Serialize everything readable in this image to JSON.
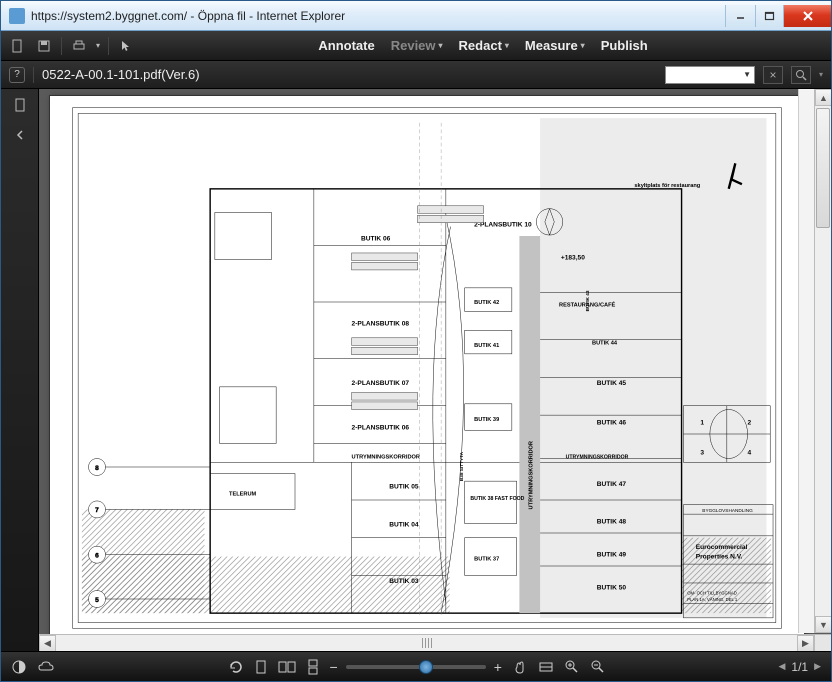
{
  "window": {
    "url_title": "https://system2.byggnet.com/ - Öppna fil - Internet Explorer"
  },
  "menu": {
    "annotate": "Annotate",
    "review": "Review",
    "redact": "Redact",
    "measure": "Measure",
    "publish": "Publish"
  },
  "subbar": {
    "help": "?",
    "filename": "0522-A-00.1-101.pdf(Ver.6)",
    "close_x": "×"
  },
  "plan": {
    "skylt": "skyltplats för\nrestaurang",
    "butik06": "BUTIK 06",
    "butik05": "BUTIK 05",
    "butik04": "BUTIK 04",
    "butik03": "BUTIK 03",
    "butik39": "BUTIK 39",
    "butik38": "BUTIK 38\nFAST FOOD",
    "butik37": "BUTIK 37",
    "butik41": "BUTIK 41",
    "butik42": "BUTIK 42",
    "butik43": "BUTIK 43",
    "butik44": "BUTIK 44",
    "butik45": "BUTIK 45",
    "butik46": "BUTIK 46",
    "butik47": "BUTIK 47",
    "butik48": "BUTIK 48",
    "butik49": "BUTIK 49",
    "butik50": "BUTIK 50",
    "plans10": "2-PLANSBUTIK 10",
    "plans08": "2-PLANSBUTIK 08",
    "plans07": "2-PLANSBUTIK 07",
    "plans06": "2-PLANSBUTIK 06",
    "utrym": "UTRYMNINGSKORRIDOR",
    "utrym2": "UTRYMNINGSKORRIDOR",
    "utrymv": "UTRYMNINGSKORRIDOR",
    "restaurang": "RESTAURANG/CAFÉ",
    "level": "+183,50",
    "telerum": "TELERUM",
    "sittyta": "B38 SITTYTA",
    "company1": "Eurocommercial",
    "company2": "Properties N.V.",
    "bygg": "BYGGLOVSHANDLING",
    "tillbygg": "OM- OCH TILLBYGGNAD",
    "plan1": "PLAN 1A, VÅNING, DEL 1",
    "axis5": "5",
    "axis6": "6",
    "axis7": "7",
    "axis8": "8"
  },
  "bottom": {
    "page": "1/1"
  }
}
